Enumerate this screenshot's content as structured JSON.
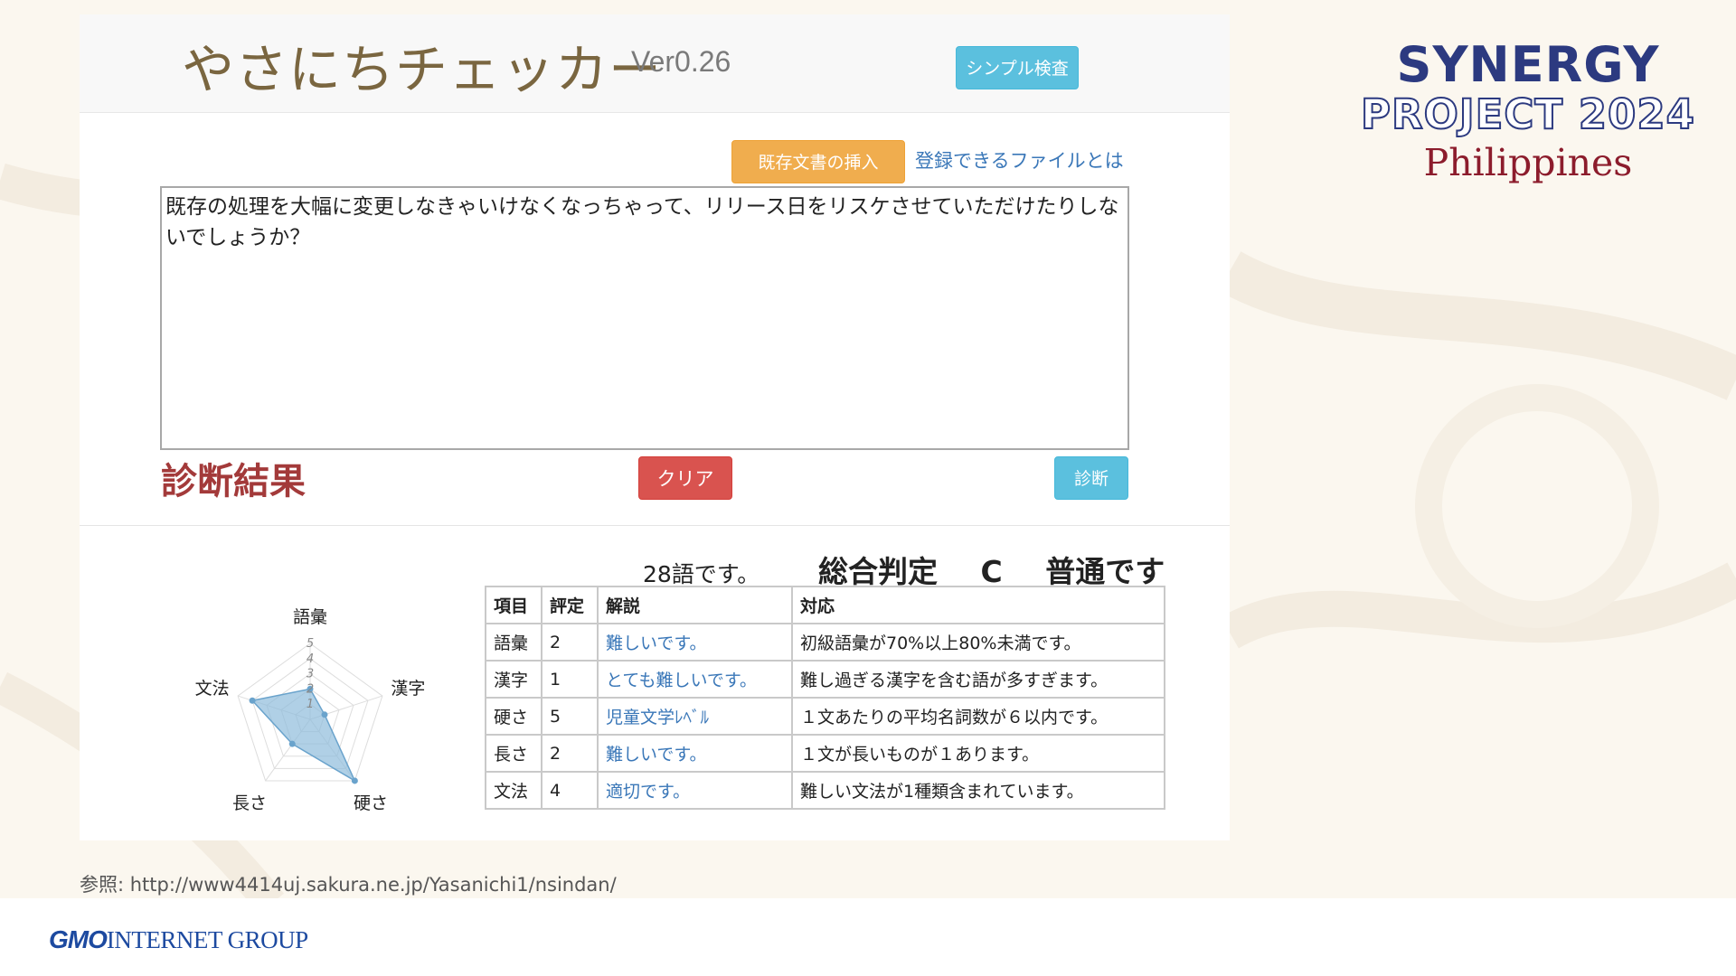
{
  "app": {
    "title": "やさにちチェッカー",
    "version": "Ver0.26",
    "simple_check_button": "シンプル検査",
    "insert_existing_button": "既存文書の挿入",
    "registrable_files_link": "登録できるファイルとは",
    "input_text": "既存の処理を大幅に変更しなきゃいけなくなっちゃって、リリース日をリスケさせていただけたりしないでしょうか？",
    "diagnosis_heading": "診断結果",
    "clear_button": "クリア",
    "diagnose_button": "診断"
  },
  "results": {
    "word_count": "28語です。",
    "overall_label": "総合判定",
    "overall_grade": "C",
    "overall_comment": "普通です",
    "table": {
      "headers": [
        "項目",
        "評定",
        "解説",
        "対応"
      ],
      "rows": [
        {
          "item": "語彙",
          "score": "2",
          "note": "難しいです。",
          "action": "初級語彙が70%以上80%未満です。"
        },
        {
          "item": "漢字",
          "score": "1",
          "note": "とても難しいです。",
          "action": "難し過ぎる漢字を含む語が多すぎます。"
        },
        {
          "item": "硬さ",
          "score": "5",
          "note": "児童文学ﾚﾍﾞﾙ",
          "action": "１文あたりの平均名詞数が６以内です。"
        },
        {
          "item": "長さ",
          "score": "2",
          "note": "難しいです。",
          "action": "１文が長いものが１あります。"
        },
        {
          "item": "文法",
          "score": "4",
          "note": "適切です。",
          "action": "難しい文法が1種類含まれています。"
        }
      ]
    }
  },
  "chart_data": {
    "type": "radar",
    "categories": [
      "語彙",
      "漢字",
      "硬さ",
      "長さ",
      "文法"
    ],
    "values": [
      2,
      1,
      5,
      2,
      4
    ],
    "ticks": [
      "1",
      "2",
      "3",
      "4",
      "5"
    ],
    "range": [
      0,
      5
    ],
    "fill_color": "#8fbcdc",
    "stroke_color": "#6aa3cc"
  },
  "reference": "参照: http://www4414uj.sakura.ne.jp/Yasanichi1/nsindan/",
  "branding": {
    "synergy_title": "SYNERGY",
    "synergy_project": "PROJECT 2024",
    "synergy_country": "Philippines",
    "gmo_mark": "GMO",
    "gmo_group": "INTERNET GROUP",
    "synergy_color": "#2c3a80",
    "country_color": "#8c1c2c"
  }
}
